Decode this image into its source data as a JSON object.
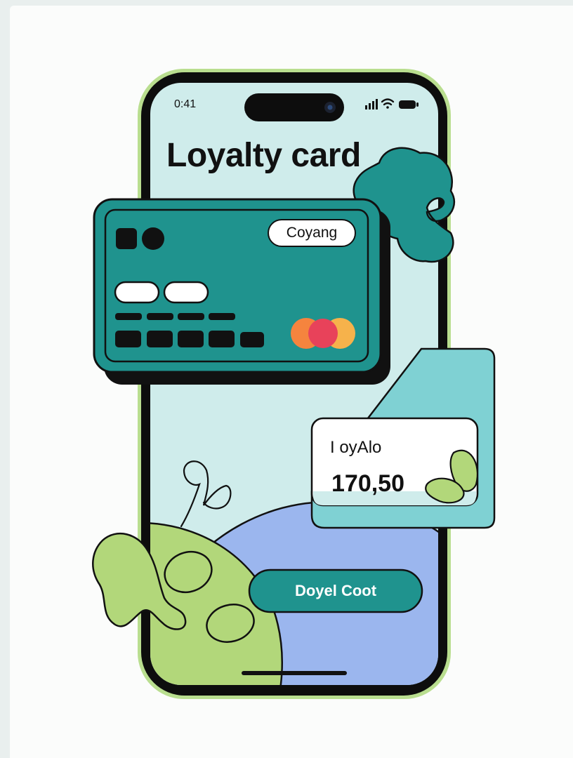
{
  "status_bar": {
    "time": "0:41"
  },
  "screen": {
    "title": "Loyalty card"
  },
  "loyalty_card": {
    "brand_label": "Coyang",
    "accent": "#1f938e",
    "network_colors": {
      "left": "#f5843e",
      "middle": "#e8425a",
      "right": "#f6b24b"
    }
  },
  "balance_card": {
    "label": "I oyAlo",
    "amount": "170,50"
  },
  "action": {
    "button_label": "Doyel Coot"
  },
  "colors": {
    "screen_bg": "#cfeceb",
    "teal": "#1f938e",
    "light_teal": "#7fd1d3",
    "blue_hill": "#9bb6ee",
    "green_blob": "#b2d77a",
    "phone_outline": "#b9de8f"
  }
}
